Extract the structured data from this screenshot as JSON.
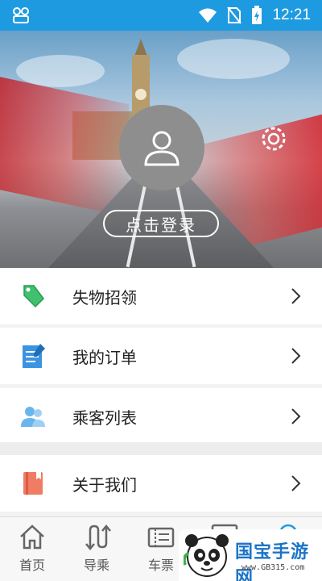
{
  "status_bar": {
    "time": "12:21"
  },
  "profile": {
    "login_label": "点击登录"
  },
  "menu": [
    {
      "label": "失物招领",
      "icon": "lost-found-tag-icon"
    },
    {
      "label": "我的订单",
      "icon": "order-document-icon"
    },
    {
      "label": "乘客列表",
      "icon": "passengers-icon"
    },
    {
      "label": "关于我们",
      "icon": "about-book-icon"
    }
  ],
  "tabs": [
    {
      "label": "首页",
      "icon": "home-icon"
    },
    {
      "label": "导乘",
      "icon": "route-guide-icon"
    },
    {
      "label": "车票",
      "icon": "ticket-icon"
    }
  ],
  "watermark": {
    "title": "国宝手游网",
    "url": "www.GB315.com"
  },
  "colors": {
    "status_bar": "#1e9be0",
    "menu_text": "#222222",
    "tab_text": "#555555"
  }
}
